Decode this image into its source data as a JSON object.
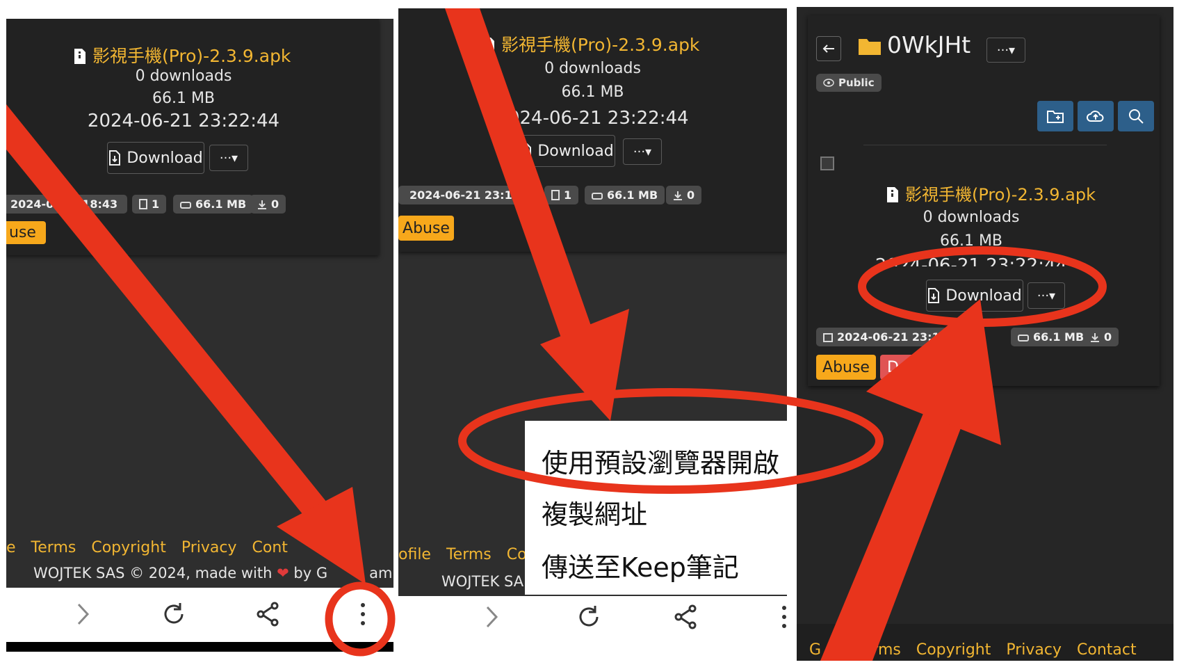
{
  "panel1": {
    "file_name": "影視手機(Pro)-2.3.9.apk",
    "downloads": "0 downloads",
    "size": "66.1 MB",
    "date": "2024-06-21 23:22:44",
    "download_label": "Download",
    "more_label": "···▾",
    "tag_date": "2024-06-   3:18:43",
    "tag_files": "1",
    "tag_size": "66.1 MB",
    "tag_downloads": "0",
    "abuse_label": "use",
    "footer_links": [
      "e",
      "Terms",
      "Copyright",
      "Privacy",
      "Cont"
    ],
    "footer_copy_a": "WOJTEK SAS © 2024, made with",
    "footer_copy_b": "by G",
    "footer_copy_c": "am"
  },
  "panel2": {
    "file_name": "影視手機(Pro)-2.3.9.apk",
    "downloads": "0 downloads",
    "size": "66.1 MB",
    "date": "2024-06-21 23:22:44",
    "download_label": "Download",
    "more_label": "···▾",
    "tag_date": "2024-06-21 23:18.",
    "tag_files": "1",
    "tag_size": "66.1 MB",
    "tag_downloads": "0",
    "abuse_label": "Abuse",
    "footer_links": [
      "ofile",
      "Terms",
      "Co"
    ],
    "footer_copy": "WOJTEK SA",
    "menu_items": [
      "使用預設瀏覽器開啟",
      "複製網址",
      "傳送至Keep筆記"
    ]
  },
  "panel3": {
    "folder_name": "0WkJHt",
    "more_label": "···▾",
    "public_badge": "Public",
    "file_name": "影視手機(Pro)-2.3.9.apk",
    "downloads": "0 downloads",
    "size": "66.1 MB",
    "date_partial": "2024-06-21 23:22:44",
    "download_label": "Download",
    "tag_date": "2024-06-21 23:18:4",
    "tag_size": "66.1 MB",
    "tag_downloads": "0",
    "abuse_label": "Abuse",
    "delete_label": "De",
    "footer_links": [
      "G",
      "Terms",
      "Copyright",
      "Privacy",
      "Contact"
    ]
  },
  "colors": {
    "accent": "#f2b632",
    "annotation": "#e8341c",
    "panel_bg": "#2e2e2e",
    "card_bg": "#222222",
    "toolbar_blue": "#2d5f8a",
    "delete_red": "#e05454"
  },
  "icons": [
    "file-zip-icon",
    "calendar-icon",
    "copy-icon",
    "drive-icon",
    "download-icon",
    "heart-icon",
    "forward-icon",
    "reload-icon",
    "share-icon",
    "more-vert-icon",
    "back-arrow-icon",
    "folder-icon",
    "eye-icon",
    "new-folder-icon",
    "upload-cloud-icon",
    "search-icon"
  ]
}
